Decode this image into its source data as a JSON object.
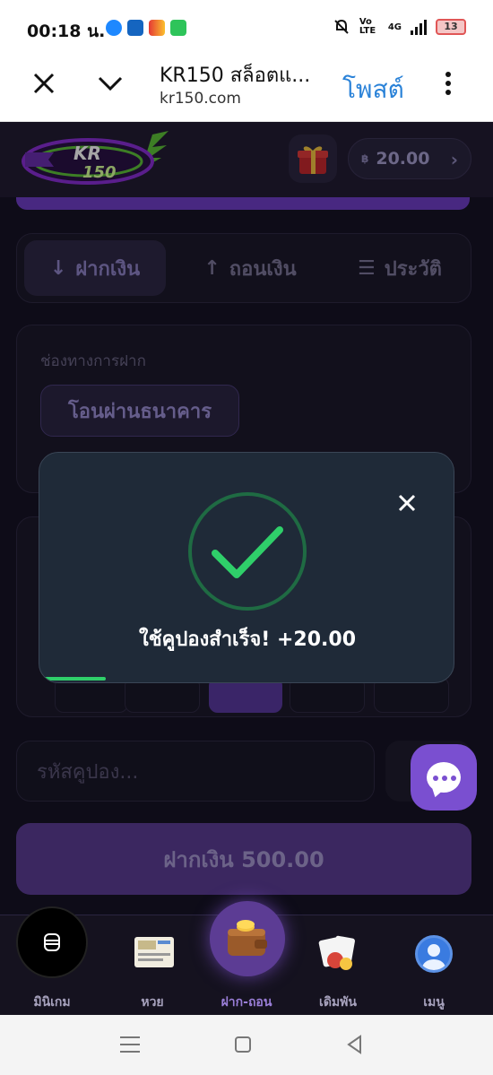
{
  "status_bar": {
    "time": "00:18 น.",
    "network": "4G",
    "volte": "Vo LTE",
    "battery": "13"
  },
  "browser": {
    "title": "KR150 สล็อตแ...",
    "url": "kr150.com",
    "post_label": "โพสต์"
  },
  "header": {
    "logo_text": "KR 150",
    "currency_symbol": "฿",
    "balance": "20.00"
  },
  "tabs": [
    {
      "icon": "↓",
      "label": "ฝากเงิน",
      "active": true
    },
    {
      "icon": "↑",
      "label": "ถอนเงิน",
      "active": false
    },
    {
      "icon": "☰",
      "label": "ประวัติ",
      "active": false
    }
  ],
  "deposit_channel": {
    "label": "ช่องทางการฝาก",
    "selected": "โอนผ่านธนาคาร"
  },
  "coupon": {
    "placeholder": "รหัสคูปอง..."
  },
  "deposit_button": {
    "label": "ฝากเงิน 500.00"
  },
  "modal": {
    "message": "ใช้คูปองสำเร็จ! +20.00",
    "progress": 0.16
  },
  "bottom_nav": [
    {
      "label": "มินิเกม",
      "icon": "mini-game-icon"
    },
    {
      "label": "หวย",
      "icon": "lottery-icon"
    },
    {
      "label": "ฝาก-ถอน",
      "icon": "wallet-icon",
      "active": true
    },
    {
      "label": "เดิมพัน",
      "icon": "cards-icon"
    },
    {
      "label": "เมนู",
      "icon": "user-avatar-icon"
    }
  ],
  "colors": {
    "accent": "#7a4fd0",
    "success": "#2fcf6a",
    "link": "#2a82d8"
  }
}
